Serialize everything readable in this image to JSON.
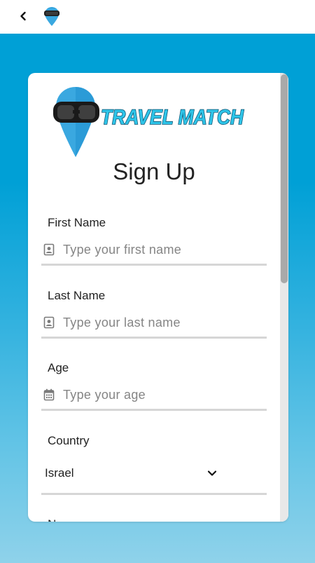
{
  "header": {
    "back_icon": "chevron-left-icon",
    "logo_icon": "travel-match-pin-icon"
  },
  "brand": {
    "name": "TRAVEL MATCH",
    "colors": {
      "primary": "#00a0d6",
      "pin": "#3aa8e0",
      "text": "#2ec4e8"
    }
  },
  "form": {
    "title": "Sign Up",
    "fields": {
      "first_name": {
        "label": "First Name",
        "placeholder": "Type your first name",
        "value": "",
        "icon": "contact-card-icon"
      },
      "last_name": {
        "label": "Last Name",
        "placeholder": "Type your last name",
        "value": "",
        "icon": "contact-card-icon"
      },
      "age": {
        "label": "Age",
        "placeholder": "Type your age",
        "value": "",
        "icon": "calendar-icon"
      },
      "country": {
        "label": "Country",
        "value": "Israel",
        "icon": "chevron-down-icon"
      }
    },
    "next_label_partial": "Name"
  }
}
